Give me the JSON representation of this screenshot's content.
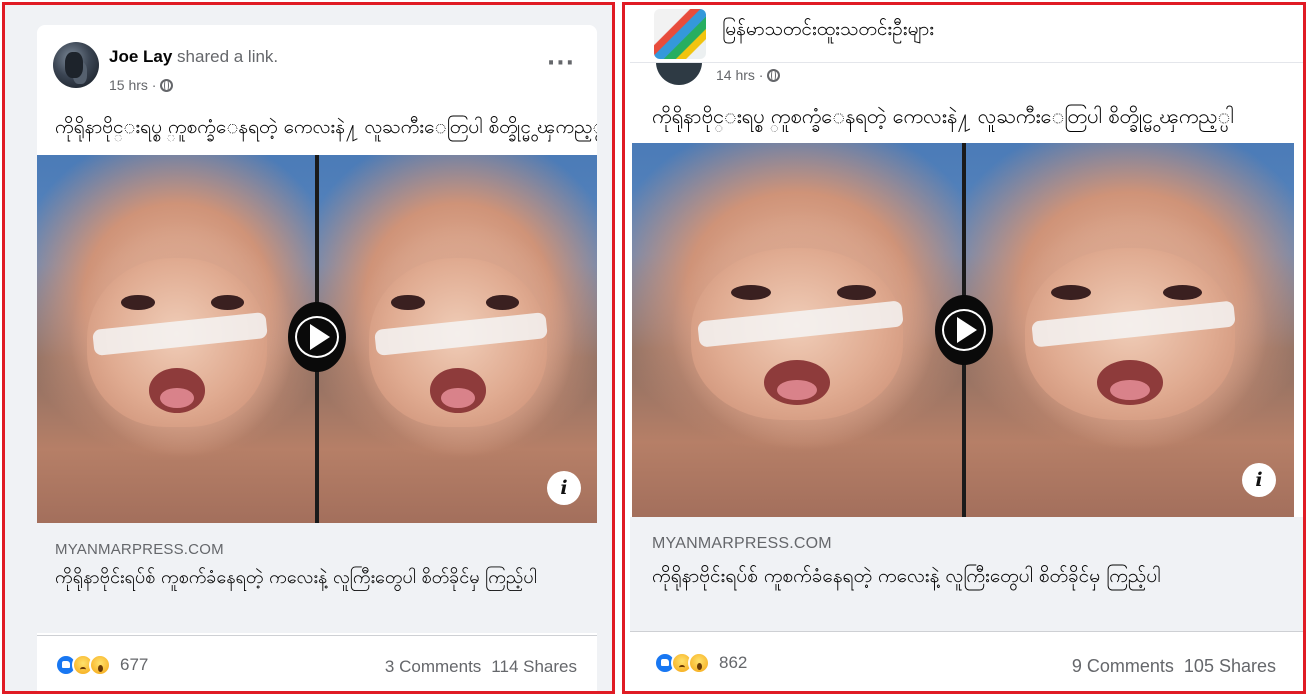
{
  "left_post": {
    "author_name": "Joe Lay",
    "author_action": "shared a link.",
    "time": "15 hrs ·",
    "more": "···",
    "text": "ကိုရိုနာဗိုင္းရပ္စ္ ကူစက္ခံေနရတဲ့ ကေလးနဲ႔ လူႀကီးေတြပါ စိတ္ခိုင္မွ ၾကည့္ပါ",
    "info": "i",
    "link_domain": "MYANMARPRESS.COM",
    "link_title": "ကိုရိုနာဗိုင်းရပ်စ် ကူစက်ခံနေရတဲ့ ကလေးနဲ့ လူကြီးတွေပါ စိတ်ခိုင်မှ ကြည့်ပါ",
    "reaction_count": "677",
    "comments": "3 Comments",
    "shares": "114 Shares"
  },
  "right_post": {
    "page_name": "မြန်မာသတင်းထူးသတင်းဦးများ",
    "time": "14 hrs ·",
    "text": "ကိုရိုနာဗိုင္းရပ္စ္ ကူစက္ခံေနရတဲ့ ကေလးနဲ႔ လူႀကီးေတြပါ စိတ္ခိုင္မွ ၾကည့္ပါ",
    "info": "i",
    "link_domain": "MYANMARPRESS.COM",
    "link_title": "ကိုရိုနာဗိုင်းရပ်စ် ကူစက်ခံနေရတဲ့ ကလေးနဲ့ လူကြီးတွေပါ စိတ်ခိုင်မှ ကြည့်ပါ",
    "reaction_count": "862",
    "comments": "9 Comments",
    "shares": "105 Shares"
  },
  "reactions": [
    "like-icon",
    "sad-icon",
    "wow-icon"
  ],
  "colors": {
    "highlight_border": "#e01b24",
    "facebook_blue": "#1877f2",
    "secondary_text": "#65676b",
    "link_preview_bg": "#f0f2f5"
  }
}
